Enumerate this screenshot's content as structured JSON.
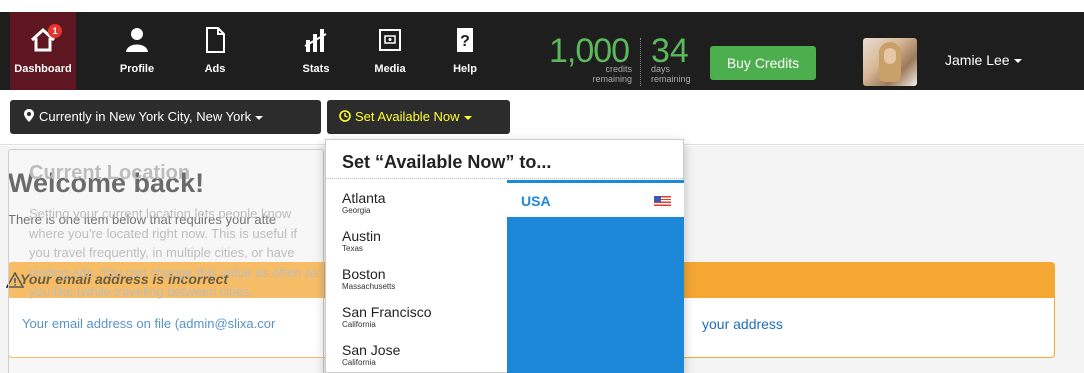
{
  "nav": {
    "items": [
      {
        "label": "Dashboard",
        "icon": "home-icon",
        "badge": "1",
        "active": true
      },
      {
        "label": "Profile",
        "icon": "user-icon"
      },
      {
        "label": "Ads",
        "icon": "document-icon"
      },
      {
        "label": "Stats",
        "icon": "stats-icon"
      },
      {
        "label": "Media",
        "icon": "media-icon"
      },
      {
        "label": "Help",
        "icon": "help-icon"
      }
    ],
    "credits_value": "1,000",
    "credits_caption": "credits remaining",
    "days_value": "34",
    "days_caption": "days remaining",
    "buy_label": "Buy Credits",
    "user_name": "Jamie Lee"
  },
  "location": {
    "current_label": "Currently in New York City, New York",
    "available_label": "Set Available Now"
  },
  "main": {
    "welcome": "Welcome back!",
    "requires_text": "There is one item below that requires your atte",
    "alert_title": "Your email address is incorrect",
    "email_message": "Your email address on file (admin@slixa.cor",
    "fix_link": "your address"
  },
  "ghost": {
    "title": "Current Location",
    "text": "Setting your current location lets people know where you're located right now. This is useful if you travel frequently, in multiple cities, or have visiting ads. You can change this value as often as you like (while traveling between cities,"
  },
  "dropdown": {
    "title": "Set “Available Now” to...",
    "cities": [
      {
        "name": "Atlanta",
        "state": "Georgia"
      },
      {
        "name": "Austin",
        "state": "Texas"
      },
      {
        "name": "Boston",
        "state": "Massachusetts"
      },
      {
        "name": "San Francisco",
        "state": "California"
      },
      {
        "name": "San Jose",
        "state": "California"
      }
    ],
    "country": "USA",
    "country_flag_icon": "us-flag-icon"
  },
  "colors": {
    "nav_bg": "#1e1e1e",
    "active_nav": "#5e1620",
    "credits_green": "#5cb85c",
    "alert_orange": "#f5a733",
    "link_blue": "#1e6fb5",
    "highlight_yellow": "#ffff33"
  }
}
